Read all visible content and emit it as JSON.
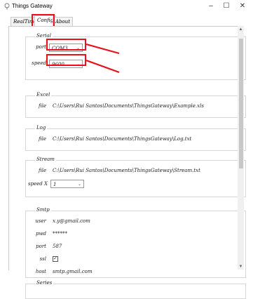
{
  "window": {
    "title": "Things Gateway",
    "controls": {
      "minimize": "–",
      "maximize": "☐",
      "close": "✕"
    }
  },
  "tabs": [
    "RealTime",
    "Config",
    "About"
  ],
  "active_tab": "Config",
  "serial": {
    "title": "Serial",
    "port_label": "port",
    "port_value": "COM3",
    "speed_label": "speed",
    "speed_value": "9600"
  },
  "excel": {
    "title": "Excel",
    "file_label": "file",
    "file_value": "C:\\Users\\Rui Santos\\Documents\\ThingsGateway\\Example.xls"
  },
  "log": {
    "title": "Log",
    "file_label": "file",
    "file_value": "C:\\Users\\Rui Santos\\Documents\\ThingsGateway\\Log.txt"
  },
  "stream": {
    "title": "Stream",
    "file_label": "file",
    "file_value": "C:\\Users\\Rui Santos\\Documents\\ThingsGateway\\Stream.txt",
    "speedx_label": "speed X",
    "speedx_value": "1"
  },
  "smtp": {
    "title": "Smtp",
    "user_label": "user",
    "user_value": "x.y@gmail.com",
    "pwd_label": "pwd",
    "pwd_value": "******",
    "port_label": "port",
    "port_value": "587",
    "ssl_label": "ssl",
    "ssl_checked": true,
    "host_label": "host",
    "host_value": "smtp.gmail.com"
  },
  "series": {
    "title": "Series"
  },
  "colors": {
    "highlight": "#e8101a"
  },
  "icons": [
    "lightbulb-icon",
    "chevron-down-icon",
    "check-icon",
    "scroll-up-icon",
    "scroll-down-icon"
  ]
}
